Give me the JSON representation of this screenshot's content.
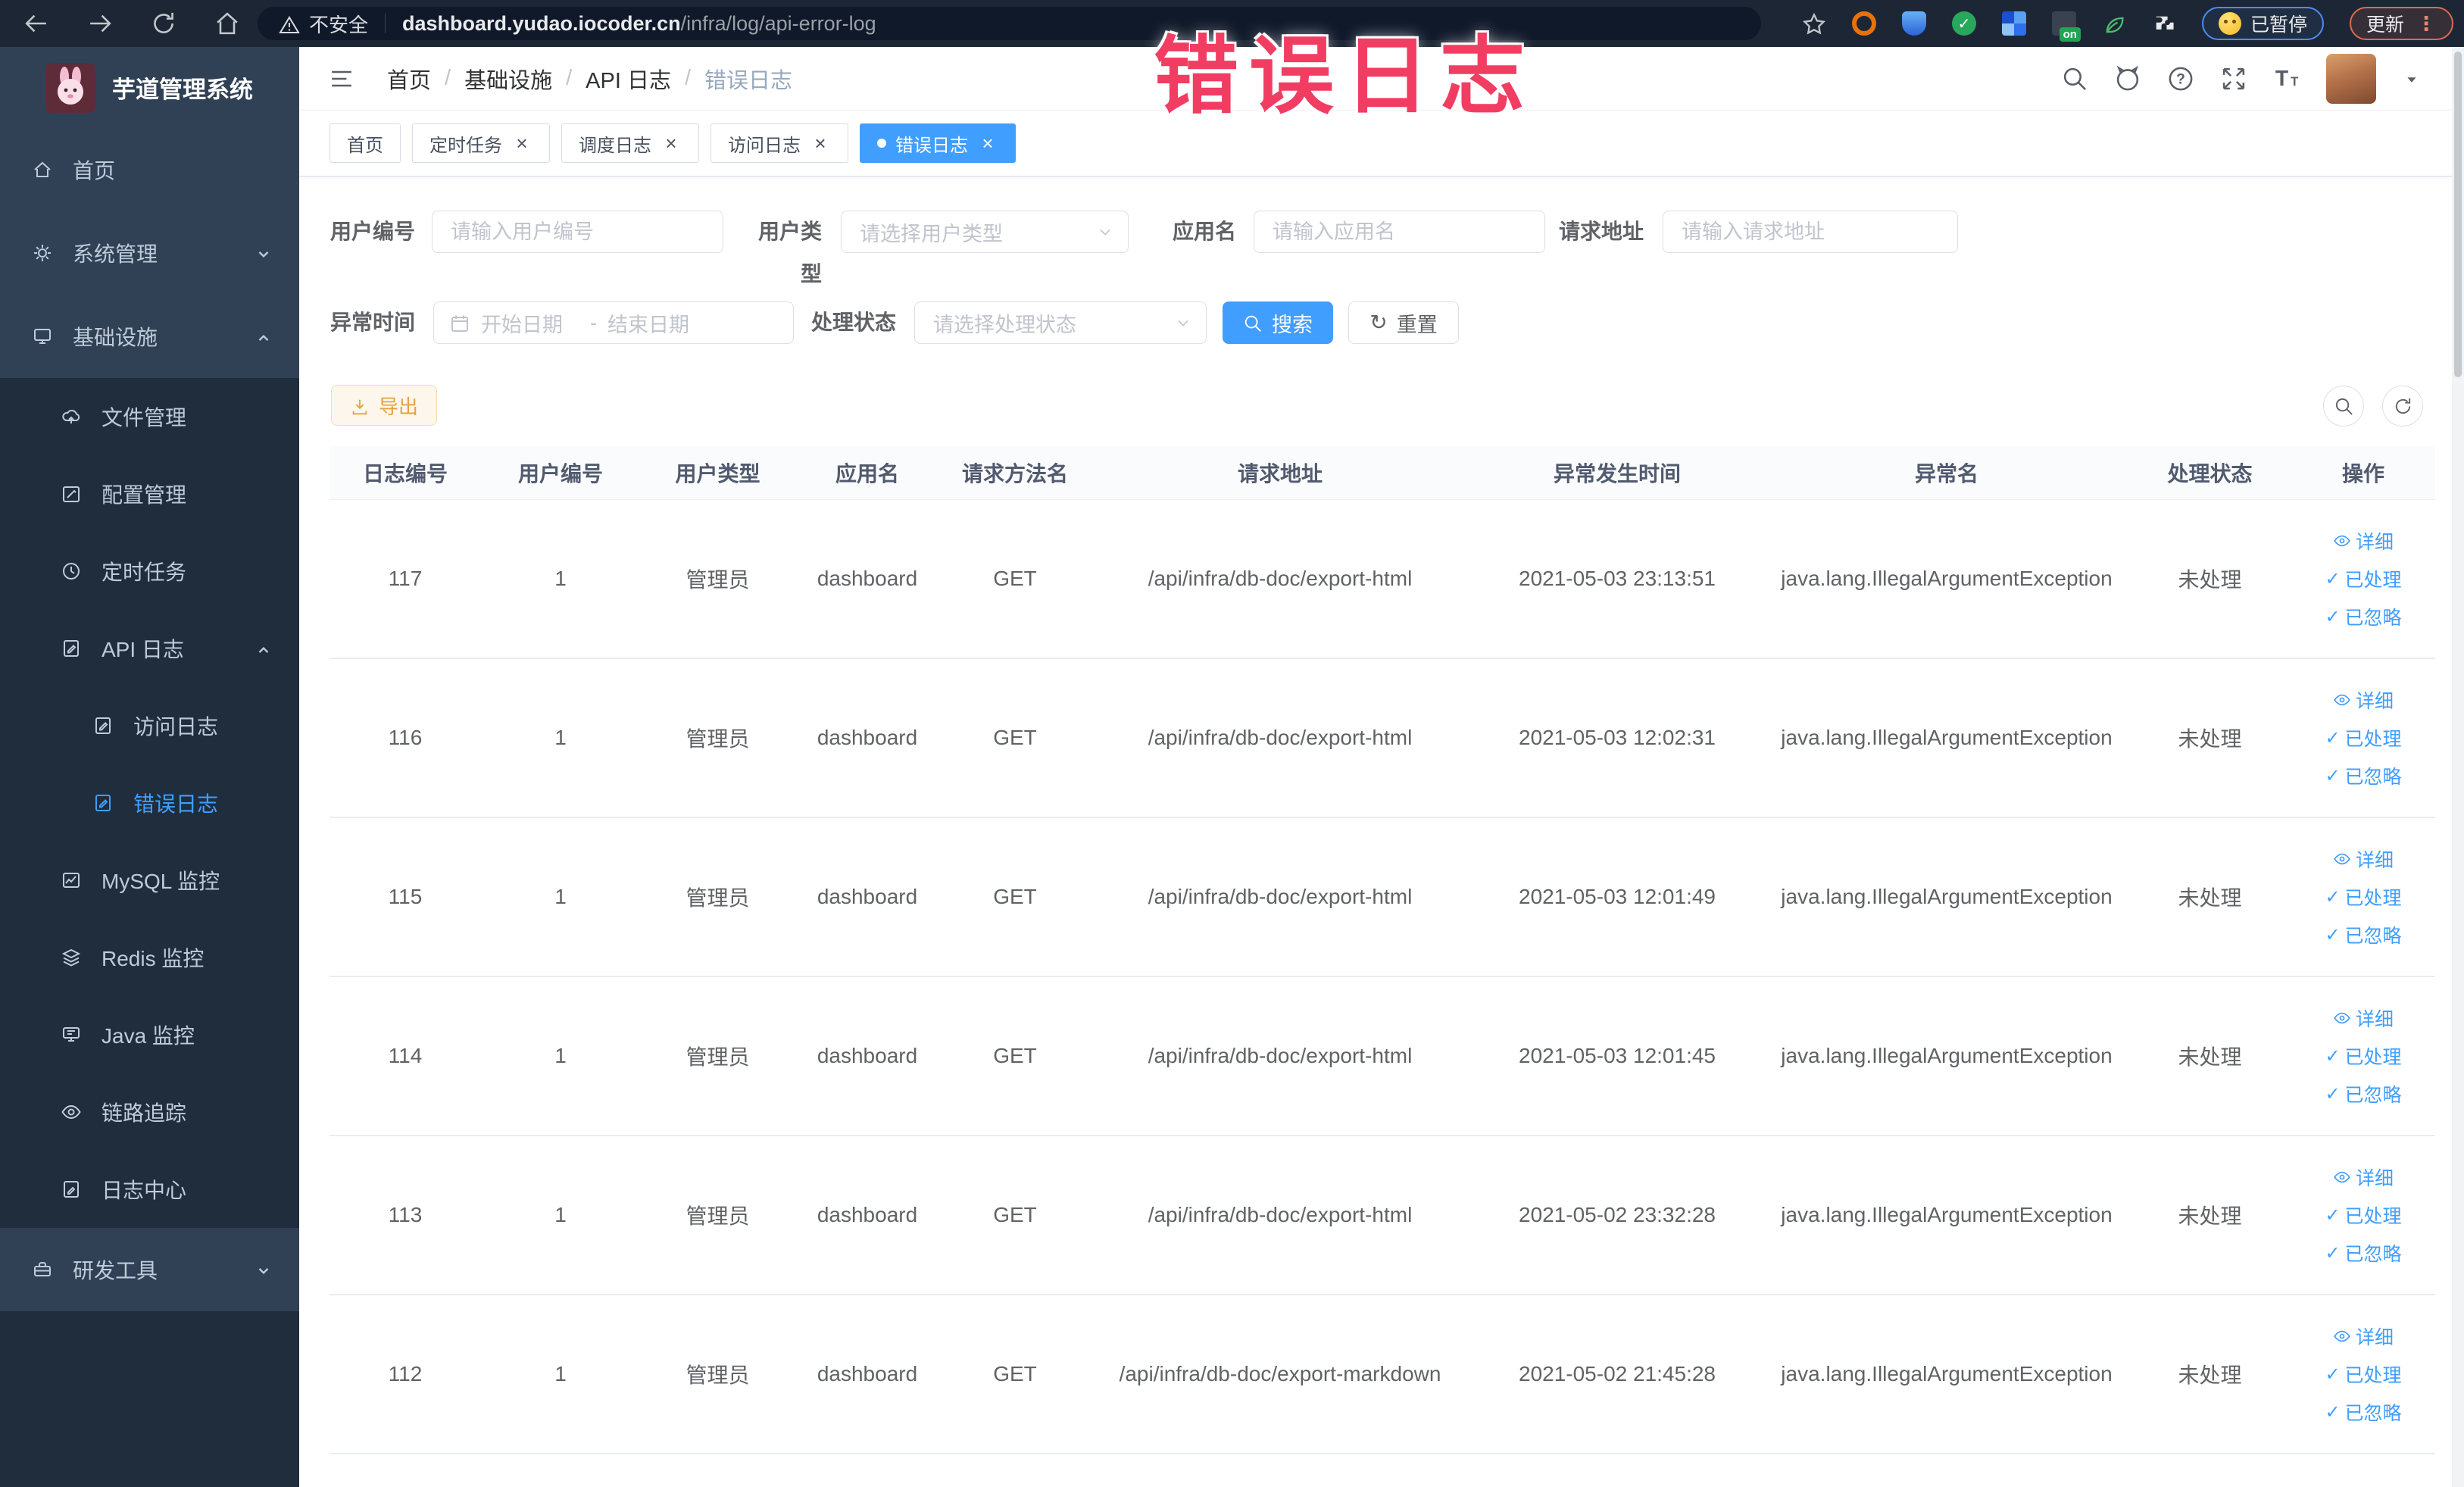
{
  "browser": {
    "security_label": "不安全",
    "url_host": "dashboard.yudao.iocoder.cn",
    "url_path": "/infra/log/api-error-log",
    "extension_badge": "on",
    "paused_label": "已暂停",
    "update_label": "更新"
  },
  "overlay": {
    "title": "错误日志"
  },
  "sidebar": {
    "logo_title": "芋道管理系统",
    "menu": [
      {
        "key": "home",
        "label": "首页",
        "icon": "home",
        "level": 1,
        "dark": false
      },
      {
        "key": "system",
        "label": "系统管理",
        "icon": "gear",
        "level": 1,
        "chevron": "down",
        "dark": false
      },
      {
        "key": "infra",
        "label": "基础设施",
        "icon": "monitor",
        "level": 1,
        "chevron": "up",
        "dark": false
      },
      {
        "key": "file",
        "label": "文件管理",
        "icon": "cloud",
        "level": 2,
        "dark": true
      },
      {
        "key": "config",
        "label": "配置管理",
        "icon": "edit",
        "level": 2,
        "dark": true
      },
      {
        "key": "job",
        "label": "定时任务",
        "icon": "clock",
        "level": 2,
        "dark": true
      },
      {
        "key": "api-log",
        "label": "API 日志",
        "icon": "formpen",
        "level": 2,
        "chevron": "up",
        "dark": true
      },
      {
        "key": "access-log",
        "label": "访问日志",
        "icon": "formpen",
        "level": 3,
        "dark": true
      },
      {
        "key": "error-log",
        "label": "错误日志",
        "icon": "formpen",
        "level": 3,
        "dark": true,
        "active": true
      },
      {
        "key": "mysql",
        "label": "MySQL 监控",
        "icon": "chart",
        "level": 2,
        "dark": true
      },
      {
        "key": "redis",
        "label": "Redis 监控",
        "icon": "layers",
        "level": 2,
        "dark": true
      },
      {
        "key": "java",
        "label": "Java 监控",
        "icon": "javamon",
        "level": 2,
        "dark": true
      },
      {
        "key": "trace",
        "label": "链路追踪",
        "icon": "eye",
        "level": 2,
        "dark": true
      },
      {
        "key": "log-center",
        "label": "日志中心",
        "icon": "logdoc",
        "level": 2,
        "dark": true
      },
      {
        "key": "dev-tools",
        "label": "研发工具",
        "icon": "toolbox",
        "level": 1,
        "chevron": "down",
        "dark": false
      }
    ]
  },
  "header": {
    "breadcrumb": [
      "首页",
      "基础设施",
      "API 日志",
      "错误日志"
    ]
  },
  "tabs": [
    {
      "label": "首页",
      "closable": false,
      "active": false
    },
    {
      "label": "定时任务",
      "closable": true,
      "active": false
    },
    {
      "label": "调度日志",
      "closable": true,
      "active": false
    },
    {
      "label": "访问日志",
      "closable": true,
      "active": false
    },
    {
      "label": "错误日志",
      "closable": true,
      "active": true
    }
  ],
  "filters": {
    "user_id_label": "用户编号",
    "user_id_placeholder": "请输入用户编号",
    "user_type_label": "用户类型",
    "user_type_placeholder": "请选择用户类型",
    "app_name_label": "应用名",
    "app_name_placeholder": "请输入应用名",
    "request_url_label": "请求地址",
    "request_url_placeholder": "请输入请求地址",
    "exception_time_label": "异常时间",
    "date_start_placeholder": "开始日期",
    "date_end_placeholder": "结束日期",
    "range_separator": "-",
    "process_status_label": "处理状态",
    "process_status_placeholder": "请选择处理状态",
    "search_label": "搜索",
    "reset_label": "重置"
  },
  "toolbar": {
    "export_label": "导出"
  },
  "table": {
    "columns": [
      "日志编号",
      "用户编号",
      "用户类型",
      "应用名",
      "请求方法名",
      "请求地址",
      "异常发生时间",
      "异常名",
      "处理状态",
      "操作"
    ],
    "actions": [
      "详细",
      "已处理",
      "已忽略"
    ],
    "rows": [
      {
        "id": "117",
        "user_id": "1",
        "user_type": "管理员",
        "app": "dashboard",
        "method": "GET",
        "url": "/api/infra/db-doc/export-html",
        "time": "2021-05-03 23:13:51",
        "exception": "java.lang.IllegalArgumentException",
        "status": "未处理"
      },
      {
        "id": "116",
        "user_id": "1",
        "user_type": "管理员",
        "app": "dashboard",
        "method": "GET",
        "url": "/api/infra/db-doc/export-html",
        "time": "2021-05-03 12:02:31",
        "exception": "java.lang.IllegalArgumentException",
        "status": "未处理"
      },
      {
        "id": "115",
        "user_id": "1",
        "user_type": "管理员",
        "app": "dashboard",
        "method": "GET",
        "url": "/api/infra/db-doc/export-html",
        "time": "2021-05-03 12:01:49",
        "exception": "java.lang.IllegalArgumentException",
        "status": "未处理"
      },
      {
        "id": "114",
        "user_id": "1",
        "user_type": "管理员",
        "app": "dashboard",
        "method": "GET",
        "url": "/api/infra/db-doc/export-html",
        "time": "2021-05-03 12:01:45",
        "exception": "java.lang.IllegalArgumentException",
        "status": "未处理"
      },
      {
        "id": "113",
        "user_id": "1",
        "user_type": "管理员",
        "app": "dashboard",
        "method": "GET",
        "url": "/api/infra/db-doc/export-html",
        "time": "2021-05-02 23:32:28",
        "exception": "java.lang.IllegalArgumentException",
        "status": "未处理"
      },
      {
        "id": "112",
        "user_id": "1",
        "user_type": "管理员",
        "app": "dashboard",
        "method": "GET",
        "url": "/api/infra/db-doc/export-markdown",
        "time": "2021-05-02 21:45:28",
        "exception": "java.lang.IllegalArgumentException",
        "status": "未处理"
      }
    ]
  },
  "colors": {
    "accent": "#409eff",
    "warning": "#e6a23c",
    "sidebar_bg": "#304156",
    "sidebar_submenu_bg": "#1f2d3d",
    "overlay_pink": "#f23d63"
  }
}
